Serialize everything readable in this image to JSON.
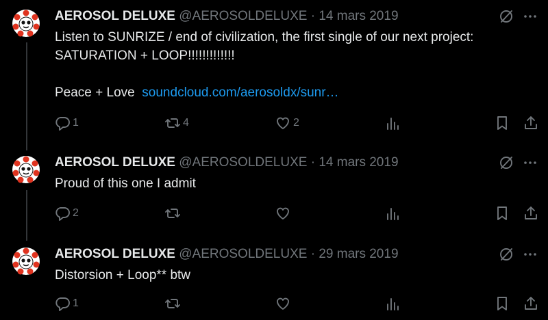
{
  "colors": {
    "background": "#000000",
    "text": "#e7e9ea",
    "muted": "#71767b",
    "link": "#1d9bf0",
    "avatar_accent": "#e0331f"
  },
  "tweets": [
    {
      "name": "AEROSOL DELUXE",
      "handle": "@AEROSOLDELUXE",
      "separator": "·",
      "date": "14 mars 2019",
      "text": "Listen to SUNRIZE / end of civilization, the first single of our next project: SATURATION + LOOP!!!!!!!!!!!!!\n\nPeace + Love  ",
      "link": "soundcloud.com/aerosoldx/sunr…",
      "replies": "1",
      "retweets": "4",
      "likes": "2"
    },
    {
      "name": "AEROSOL DELUXE",
      "handle": "@AEROSOLDELUXE",
      "separator": "·",
      "date": "14 mars 2019",
      "text": "Proud of this one I admit",
      "link": "",
      "replies": "2",
      "retweets": "",
      "likes": ""
    },
    {
      "name": "AEROSOL DELUXE",
      "handle": "@AEROSOLDELUXE",
      "separator": "·",
      "date": "29 mars 2019",
      "text": "Distorsion + Loop** btw",
      "link": "",
      "replies": "1",
      "retweets": "",
      "likes": ""
    }
  ],
  "icons": [
    "reply-icon",
    "retweet-icon",
    "like-icon",
    "views-icon",
    "bookmark-icon",
    "share-icon",
    "grok-icon",
    "more-icon"
  ]
}
